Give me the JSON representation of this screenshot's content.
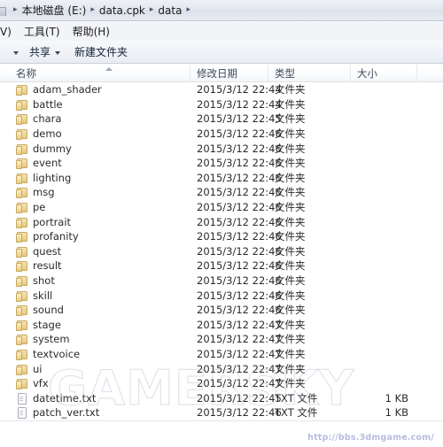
{
  "window": {
    "breadcrumb": {
      "separator": "▸",
      "items": [
        {
          "label": "本地磁盘 (E:)"
        },
        {
          "label": "data.cpk"
        },
        {
          "label": "data"
        }
      ]
    },
    "menubar": {
      "items": [
        {
          "label": "V)"
        },
        {
          "label": "工具(T)"
        },
        {
          "label": "帮助(H)"
        }
      ]
    },
    "toolbar": {
      "organize_label": "",
      "share_label": "共享",
      "new_folder_label": "新建文件夹"
    }
  },
  "file_list": {
    "columns": [
      {
        "key": "name",
        "label": "名称",
        "sorted": "asc"
      },
      {
        "key": "date",
        "label": "修改日期"
      },
      {
        "key": "type",
        "label": "类型"
      },
      {
        "key": "size",
        "label": "大小"
      }
    ],
    "folder_type_label": "文件夹",
    "txt_type_label": "TXT 文件",
    "rows": [
      {
        "name": "adam_shader",
        "date": "2015/3/12 22:44",
        "type": "文件夹",
        "size": "",
        "icon": "folder-icon"
      },
      {
        "name": "battle",
        "date": "2015/3/12 22:44",
        "type": "文件夹",
        "size": "",
        "icon": "folder-icon"
      },
      {
        "name": "chara",
        "date": "2015/3/12 22:45",
        "type": "文件夹",
        "size": "",
        "icon": "folder-icon"
      },
      {
        "name": "demo",
        "date": "2015/3/12 22:46",
        "type": "文件夹",
        "size": "",
        "icon": "folder-icon"
      },
      {
        "name": "dummy",
        "date": "2015/3/12 22:46",
        "type": "文件夹",
        "size": "",
        "icon": "folder-icon"
      },
      {
        "name": "event",
        "date": "2015/3/12 22:46",
        "type": "文件夹",
        "size": "",
        "icon": "folder-icon"
      },
      {
        "name": "lighting",
        "date": "2015/3/12 22:46",
        "type": "文件夹",
        "size": "",
        "icon": "folder-icon"
      },
      {
        "name": "msg",
        "date": "2015/3/12 22:46",
        "type": "文件夹",
        "size": "",
        "icon": "folder-icon"
      },
      {
        "name": "pe",
        "date": "2015/3/12 22:46",
        "type": "文件夹",
        "size": "",
        "icon": "folder-icon"
      },
      {
        "name": "portrait",
        "date": "2015/3/12 22:46",
        "type": "文件夹",
        "size": "",
        "icon": "folder-icon"
      },
      {
        "name": "profanity",
        "date": "2015/3/12 22:46",
        "type": "文件夹",
        "size": "",
        "icon": "folder-icon"
      },
      {
        "name": "quest",
        "date": "2015/3/12 22:46",
        "type": "文件夹",
        "size": "",
        "icon": "folder-icon"
      },
      {
        "name": "result",
        "date": "2015/3/12 22:46",
        "type": "文件夹",
        "size": "",
        "icon": "folder-icon"
      },
      {
        "name": "shot",
        "date": "2015/3/12 22:46",
        "type": "文件夹",
        "size": "",
        "icon": "folder-icon"
      },
      {
        "name": "skill",
        "date": "2015/3/12 22:46",
        "type": "文件夹",
        "size": "",
        "icon": "folder-icon"
      },
      {
        "name": "sound",
        "date": "2015/3/12 22:46",
        "type": "文件夹",
        "size": "",
        "icon": "folder-icon"
      },
      {
        "name": "stage",
        "date": "2015/3/12 22:47",
        "type": "文件夹",
        "size": "",
        "icon": "folder-icon"
      },
      {
        "name": "system",
        "date": "2015/3/12 22:47",
        "type": "文件夹",
        "size": "",
        "icon": "folder-icon"
      },
      {
        "name": "textvoice",
        "date": "2015/3/12 22:47",
        "type": "文件夹",
        "size": "",
        "icon": "folder-icon"
      },
      {
        "name": "ui",
        "date": "2015/3/12 22:47",
        "type": "文件夹",
        "size": "",
        "icon": "folder-icon"
      },
      {
        "name": "vfx",
        "date": "2015/3/12 22:47",
        "type": "文件夹",
        "size": "",
        "icon": "folder-icon"
      },
      {
        "name": "datetime.txt",
        "date": "2015/3/12 22:45",
        "type": "TXT 文件",
        "size": "1 KB",
        "icon": "text-file-icon"
      },
      {
        "name": "patch_ver.txt",
        "date": "2015/3/12 22:46",
        "type": "TXT 文件",
        "size": "1 KB",
        "icon": "text-file-icon"
      }
    ]
  },
  "watermarks": {
    "brand": "GAMERSKY",
    "url": "http://bbs.3dmgame.com/",
    "brand_color": "#96a0b9",
    "url_color": "#b9bbe0"
  }
}
